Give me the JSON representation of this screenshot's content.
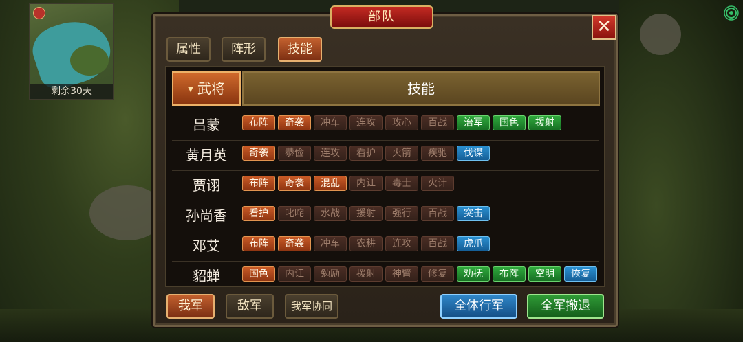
{
  "panel": {
    "title": "部队",
    "close_label": "✕"
  },
  "tabs": [
    {
      "label": "属性"
    },
    {
      "label": "阵形"
    },
    {
      "label": "技能"
    }
  ],
  "table": {
    "header_general": "武将",
    "header_skill": "技能",
    "rows": [
      {
        "name": "吕蒙",
        "skills": [
          {
            "label": "布阵",
            "style": "o"
          },
          {
            "label": "奇袭",
            "style": "o"
          },
          {
            "label": "冲车",
            "style": "d"
          },
          {
            "label": "连攻",
            "style": "d"
          },
          {
            "label": "攻心",
            "style": "d"
          },
          {
            "label": "百战",
            "style": "d"
          },
          {
            "label": "治军",
            "style": "g"
          },
          {
            "label": "国色",
            "style": "g"
          },
          {
            "label": "援射",
            "style": "g"
          }
        ]
      },
      {
        "name": "黄月英",
        "skills": [
          {
            "label": "奇袭",
            "style": "o"
          },
          {
            "label": "恭俭",
            "style": "d"
          },
          {
            "label": "连攻",
            "style": "d"
          },
          {
            "label": "看护",
            "style": "d"
          },
          {
            "label": "火箭",
            "style": "d"
          },
          {
            "label": "疾驰",
            "style": "d"
          },
          {
            "label": "伐谋",
            "style": "b"
          }
        ]
      },
      {
        "name": "贾诩",
        "skills": [
          {
            "label": "布阵",
            "style": "o"
          },
          {
            "label": "奇袭",
            "style": "o"
          },
          {
            "label": "混乱",
            "style": "o"
          },
          {
            "label": "内讧",
            "style": "d"
          },
          {
            "label": "毒士",
            "style": "d"
          },
          {
            "label": "火计",
            "style": "d"
          }
        ]
      },
      {
        "name": "孙尚香",
        "skills": [
          {
            "label": "看护",
            "style": "o"
          },
          {
            "label": "叱咤",
            "style": "d"
          },
          {
            "label": "水战",
            "style": "d"
          },
          {
            "label": "援射",
            "style": "d"
          },
          {
            "label": "强行",
            "style": "d"
          },
          {
            "label": "百战",
            "style": "d"
          },
          {
            "label": "突击",
            "style": "b"
          }
        ]
      },
      {
        "name": "邓艾",
        "skills": [
          {
            "label": "布阵",
            "style": "o"
          },
          {
            "label": "奇袭",
            "style": "o"
          },
          {
            "label": "冲车",
            "style": "d"
          },
          {
            "label": "农耕",
            "style": "d"
          },
          {
            "label": "连攻",
            "style": "d"
          },
          {
            "label": "百战",
            "style": "d"
          },
          {
            "label": "虎爪",
            "style": "b"
          }
        ]
      },
      {
        "name": "貂蝉",
        "skills": [
          {
            "label": "国色",
            "style": "o"
          },
          {
            "label": "内讧",
            "style": "d"
          },
          {
            "label": "勉励",
            "style": "d"
          },
          {
            "label": "援射",
            "style": "d"
          },
          {
            "label": "神臂",
            "style": "d"
          },
          {
            "label": "修复",
            "style": "d"
          },
          {
            "label": "劝抚",
            "style": "g"
          },
          {
            "label": "布阵",
            "style": "g"
          },
          {
            "label": "空明",
            "style": "g"
          },
          {
            "label": "恢复",
            "style": "b"
          }
        ]
      }
    ]
  },
  "bottom": {
    "our_army": "我军",
    "enemy_army": "敌军",
    "our_coop": "我军协同",
    "all_march": "全体行军",
    "all_retreat": "全军撤退"
  },
  "minimap": {
    "days_left": "剩余30天"
  }
}
